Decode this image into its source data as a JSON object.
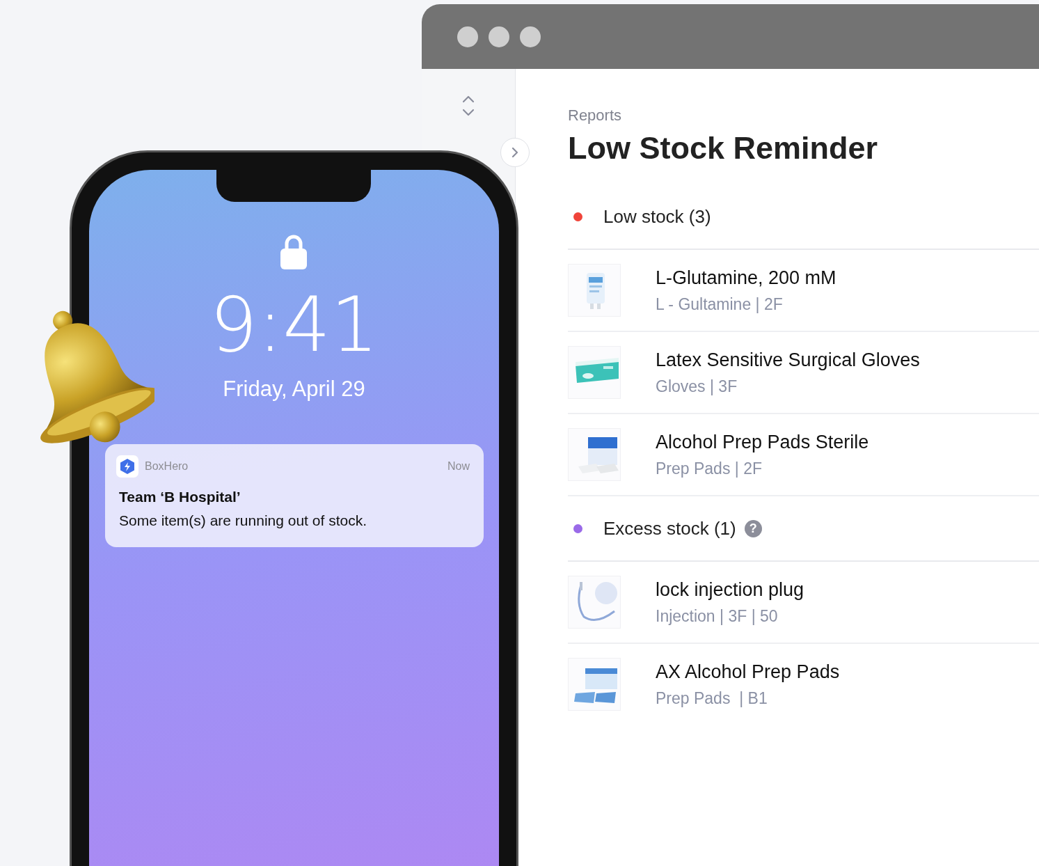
{
  "browser": {
    "breadcrumb": "Reports",
    "title": "Low Stock Reminder",
    "sections": [
      {
        "label": "Low stock (3)",
        "color": "#f0443a",
        "items": [
          {
            "name": "L-Glutamine, 200 mM",
            "detail": "L - Gultamine | 2F"
          },
          {
            "name": "Latex Sensitive Surgical Gloves",
            "detail": "Gloves | 3F"
          },
          {
            "name": "Alcohol Prep Pads Sterile",
            "detail": "Prep Pads | 2F"
          }
        ]
      },
      {
        "label": "Excess stock (1)",
        "color": "#9a6ae8",
        "help": "?",
        "items": [
          {
            "name": "lock injection plug",
            "detail": "Injection | 3F | 50"
          },
          {
            "name": "AX Alcohol Prep Pads",
            "detail": "Prep Pads  | B1"
          }
        ]
      }
    ]
  },
  "phone": {
    "time": "9:41",
    "date": "Friday, April 29",
    "notification": {
      "app": "BoxHero",
      "time": "Now",
      "title": "Team ‘B Hospital’",
      "body": "Some item(s) are running out of stock."
    }
  }
}
